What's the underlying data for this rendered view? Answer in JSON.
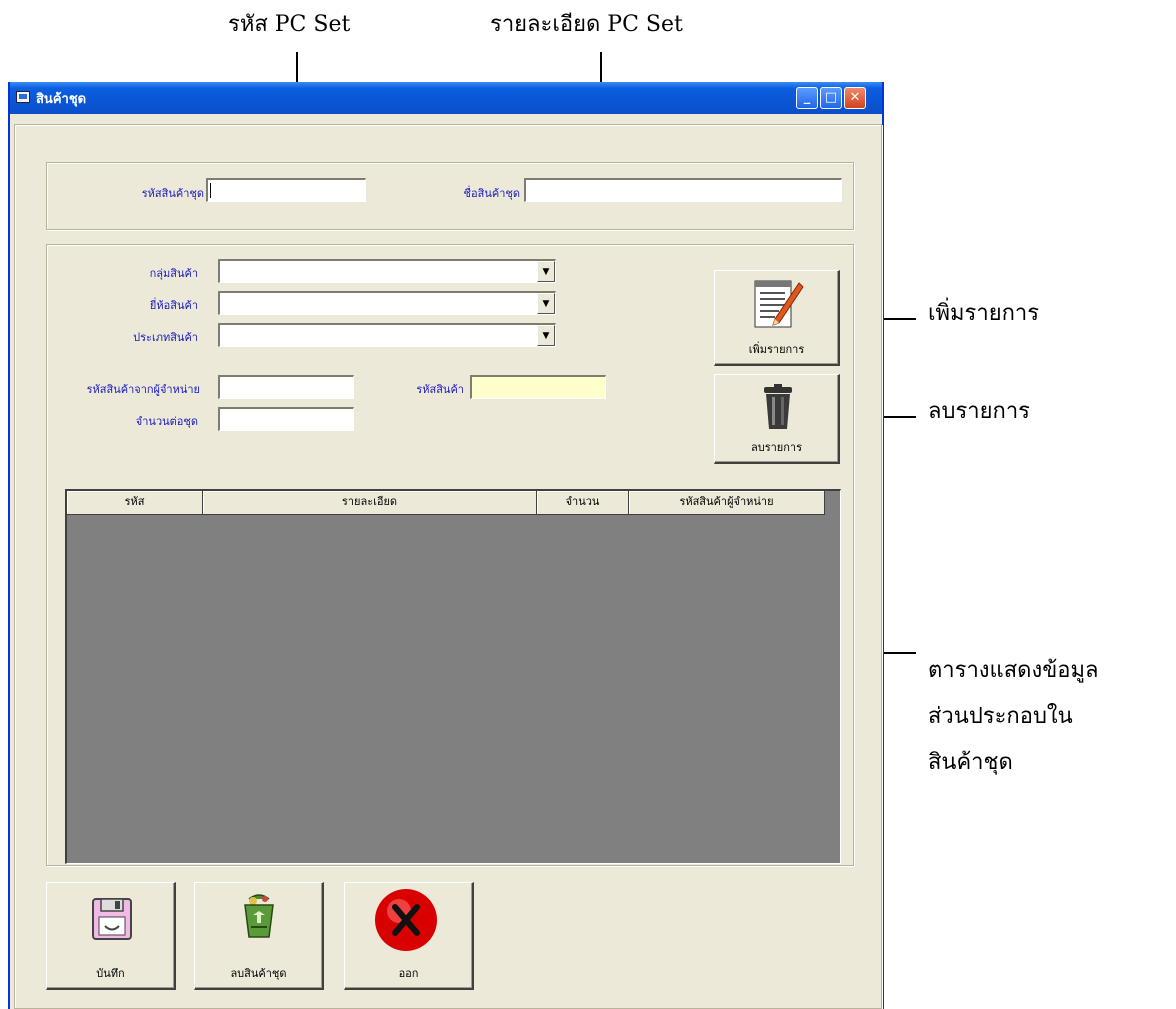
{
  "callouts": {
    "pc_set_code": "รหัส PC Set",
    "pc_set_detail": "รายละเอียด PC Set",
    "add_item": "เพิ่มรายการ",
    "delete_item": "ลบรายการ",
    "grid_note": [
      "ตารางแสดงข้อมูล",
      "ส่วนประกอบใน",
      "สินค้าชุด"
    ]
  },
  "window": {
    "title": "สินค้าชุด",
    "minimize": "_",
    "maximize": "□",
    "close": "✕"
  },
  "header_form": {
    "code_label": "รหัสสินค้าชุด",
    "code_value": "",
    "name_label": "ชื่อสินค้าชุด",
    "name_value": ""
  },
  "item_form": {
    "group_label": "กลุ่มสินค้า",
    "brand_label": "ยี่ห้อสินค้า",
    "type_label": "ประเภทสินค้า",
    "supplier_code_label": "รหัสสินค้าจากผู้จำหน่าย",
    "product_code_label": "รหัสสินค้า",
    "qty_label": "จำนวนต่อชุด",
    "combo_arrow": "▼"
  },
  "buttons": {
    "add": "เพิ่มรายการ",
    "delete": "ลบรายการ",
    "save": "บันทึก",
    "delete_set": "ลบสินค้าชุด",
    "exit": "ออก"
  },
  "grid": {
    "columns": [
      "รหัส",
      "รายละเอียด",
      "จำนวน",
      "รหัสสินค้าผู้จำหน่าย"
    ]
  },
  "icons": [
    "window-app-icon",
    "notepad-pencil-icon",
    "trash-can-icon",
    "floppy-disk-icon",
    "recycle-bin-icon",
    "exit-x-icon"
  ]
}
